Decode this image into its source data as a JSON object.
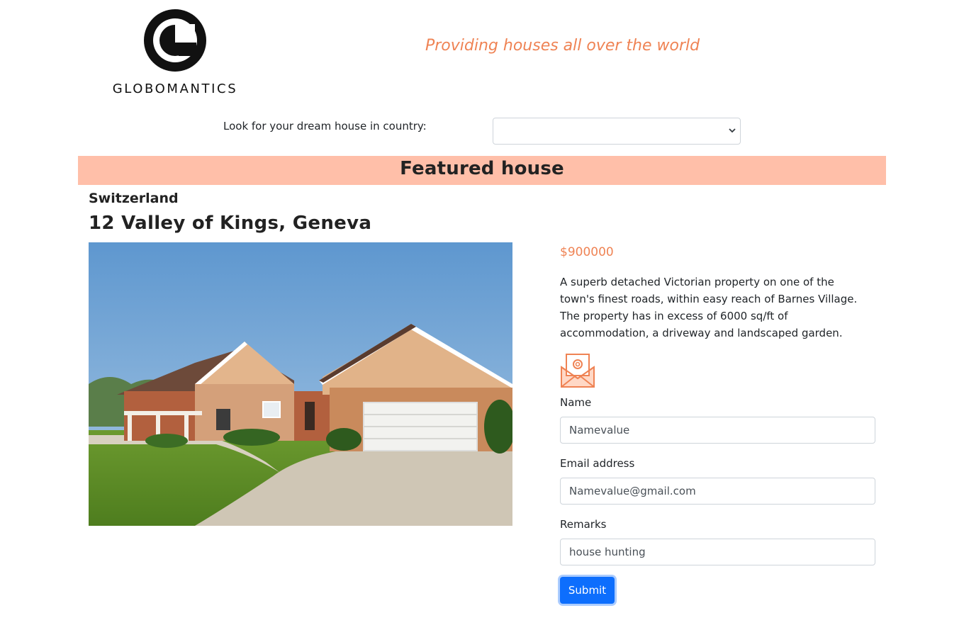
{
  "header": {
    "logo_text": "GLOBOMANTICS",
    "tagline": "Providing houses all over the world"
  },
  "search": {
    "label": "Look for your dream house in country:",
    "selected_country": ""
  },
  "featured": {
    "banner_title": "Featured house",
    "country": "Switzerland",
    "address": "12 Valley of Kings, Geneva",
    "price": "$900000",
    "description": "A superb detached Victorian property on one of the town's finest roads, within easy reach of Barnes Village. The property has in excess of 6000 sq/ft of accommodation, a driveway and landscaped garden."
  },
  "form": {
    "name_label": "Name",
    "name_value": "Namevalue",
    "email_label": "Email address",
    "email_value": "Namevalue@gmail.com",
    "remarks_label": "Remarks",
    "remarks_value": "house hunting",
    "submit_label": "Submit"
  },
  "colors": {
    "accent": "#ef8354",
    "banner_bg": "#ffbfa9",
    "button": "#0d6efd"
  },
  "icons": {
    "logo": "globomantics-g-logo",
    "mail": "envelope-at-icon",
    "select_arrow": "chevron-down-icon"
  }
}
